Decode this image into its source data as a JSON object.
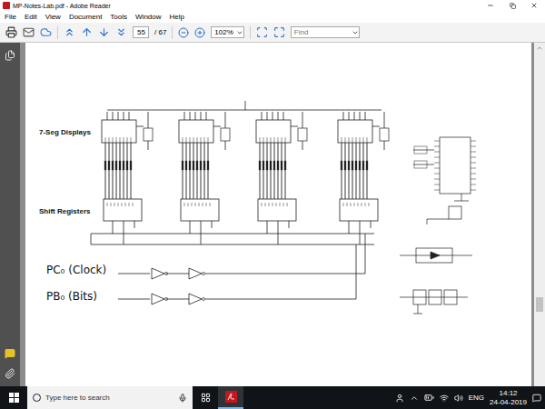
{
  "window": {
    "title": "MP-Notes-Lab.pdf - Adobe Reader"
  },
  "menu": [
    "File",
    "Edit",
    "View",
    "Document",
    "Tools",
    "Window",
    "Help"
  ],
  "toolbar": {
    "page": "55",
    "page_count": "/ 67",
    "zoom": "102%",
    "find_placeholder": "Find"
  },
  "document": {
    "labels": {
      "displays": "7-Seg Displays",
      "registers": "Shift Registers",
      "clock": "PC₀ (Clock)",
      "bits": "PB₀ (Bits)"
    }
  },
  "taskbar": {
    "search_placeholder": "Type here to search",
    "language": "ENG",
    "time": "14:12",
    "date": "24-04-2019"
  }
}
